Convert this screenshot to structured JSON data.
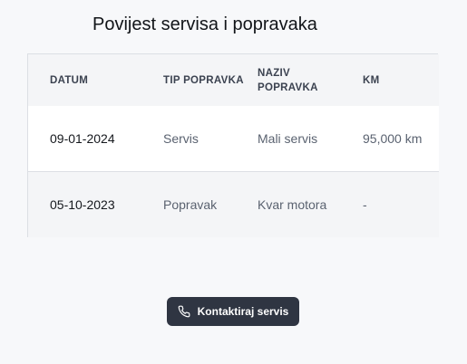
{
  "page": {
    "title": "Povijest servisa i popravaka"
  },
  "table": {
    "headers": [
      "DATUM",
      "TIP POPRAVKA",
      "NAZIV POPRAVKA",
      "KM"
    ],
    "rows": [
      [
        "09-01-2024",
        "Servis",
        "Mali servis",
        "95,000 km"
      ],
      [
        "05-10-2023",
        "Popravak",
        "Kvar motora",
        "-"
      ]
    ]
  },
  "actions": {
    "contact_label": "Kontaktiraj servis",
    "contact_icon": "phone-icon"
  }
}
